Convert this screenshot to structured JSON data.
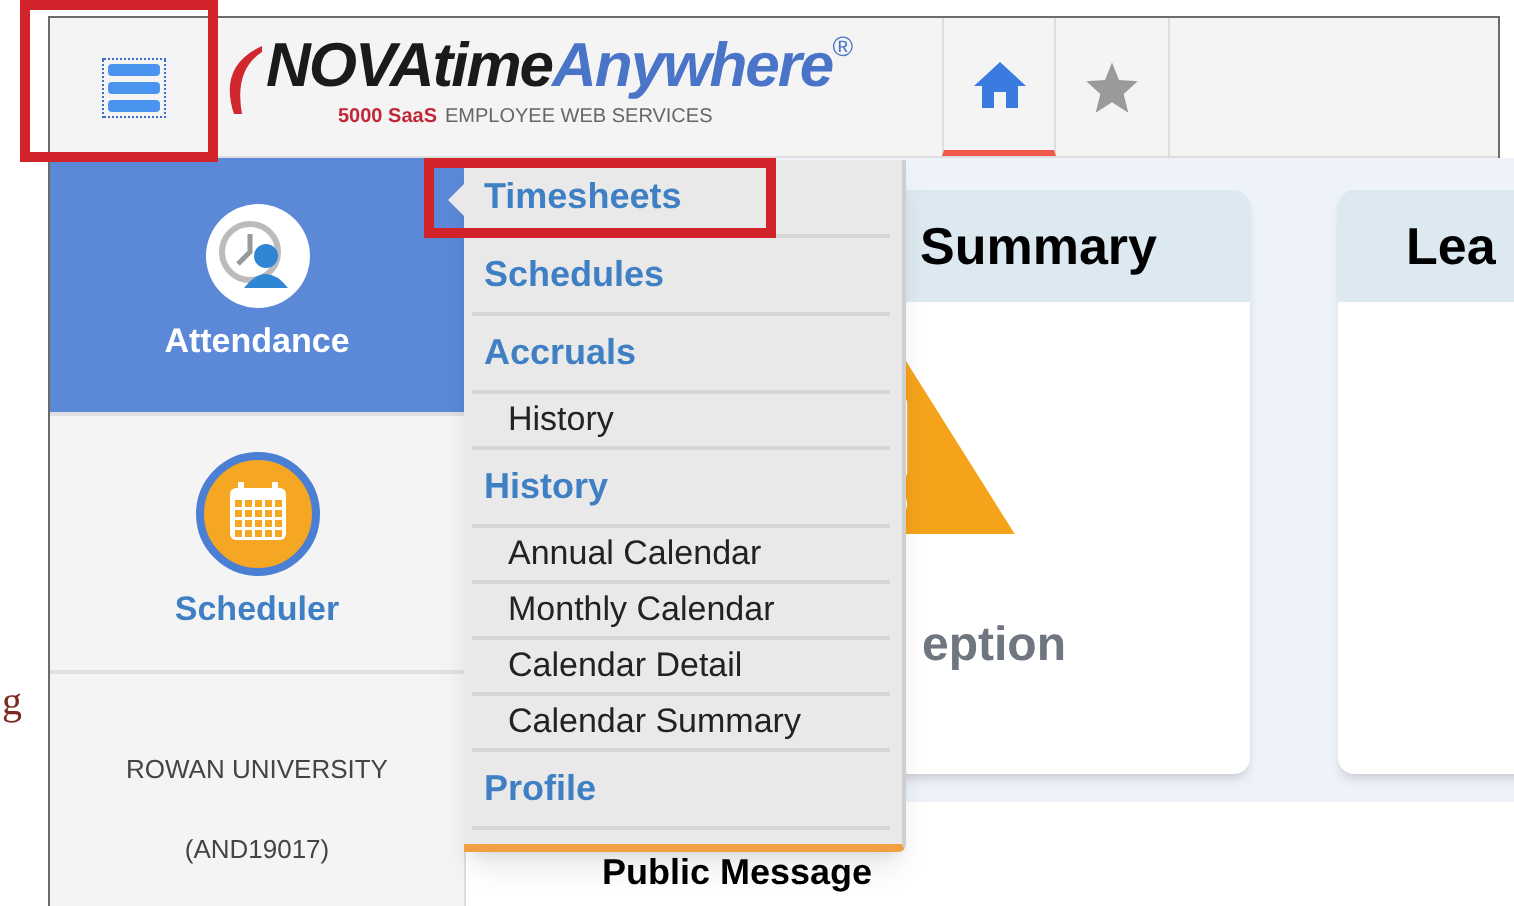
{
  "margin_text": "g",
  "nav_menu_button": {
    "highlighted": true
  },
  "logo": {
    "brand_left": "NOVAtime",
    "brand_right": "Anywhere",
    "registered": "®",
    "edition": "5000 SaaS",
    "tagline": "EMPLOYEE WEB SERVICES"
  },
  "header_tabs": [
    {
      "kind": "home",
      "selected": true
    },
    {
      "kind": "star",
      "selected": false
    }
  ],
  "sidebar": {
    "modules": [
      {
        "label": "Attendance",
        "kind": "attendance",
        "selected": true
      },
      {
        "label": "Scheduler",
        "kind": "scheduler",
        "selected": false
      }
    ],
    "company": "ROWAN UNIVERSITY",
    "company_code": "(AND19017)"
  },
  "cards": [
    {
      "title": "Summary",
      "kind": "warning",
      "caption": "eption"
    },
    {
      "title": "Lea",
      "kind": "empty"
    }
  ],
  "public_message": {
    "title": "Public Message"
  },
  "dropdown": {
    "items": [
      {
        "label": "Timesheets",
        "kind": "section",
        "highlighted": true
      },
      {
        "label": "Schedules",
        "kind": "section",
        "highlighted": false
      },
      {
        "label": "Accruals",
        "kind": "section",
        "highlighted": false
      },
      {
        "label": "History",
        "kind": "sub",
        "highlighted": false
      },
      {
        "label": "History",
        "kind": "section",
        "highlighted": false
      },
      {
        "label": "Annual Calendar",
        "kind": "sub",
        "highlighted": false
      },
      {
        "label": "Monthly Calendar",
        "kind": "sub",
        "highlighted": false
      },
      {
        "label": "Calendar Detail",
        "kind": "sub",
        "highlighted": false
      },
      {
        "label": "Calendar Summary",
        "kind": "sub",
        "highlighted": false
      },
      {
        "label": "Profile",
        "kind": "section",
        "highlighted": false
      }
    ]
  }
}
